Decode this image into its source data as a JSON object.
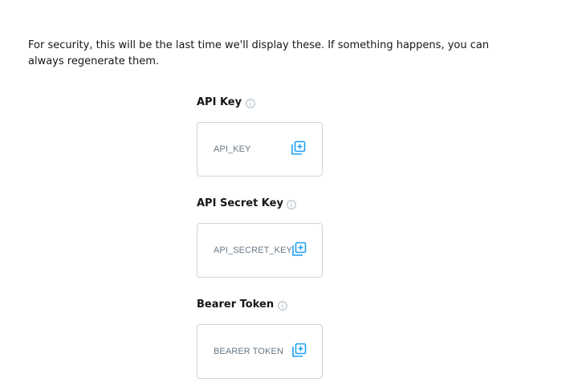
{
  "notice": "For security, this will be the last time we'll display these. If something happens, you can always regenerate them.",
  "keys": [
    {
      "label": "API Key",
      "value": "API_KEY",
      "info_icon": "info-icon",
      "copy_icon": "copy-icon"
    },
    {
      "label": "API Secret Key",
      "value": "API_SECRET_KEY",
      "info_icon": "info-icon",
      "copy_icon": "copy-icon"
    },
    {
      "label": "Bearer Token",
      "value": "BEARER TOKEN",
      "info_icon": "info-icon",
      "copy_icon": "copy-icon"
    }
  ],
  "colors": {
    "accent": "#1da1f2",
    "text": "#14171a",
    "muted": "#657786",
    "border": "#ccd6dd"
  }
}
